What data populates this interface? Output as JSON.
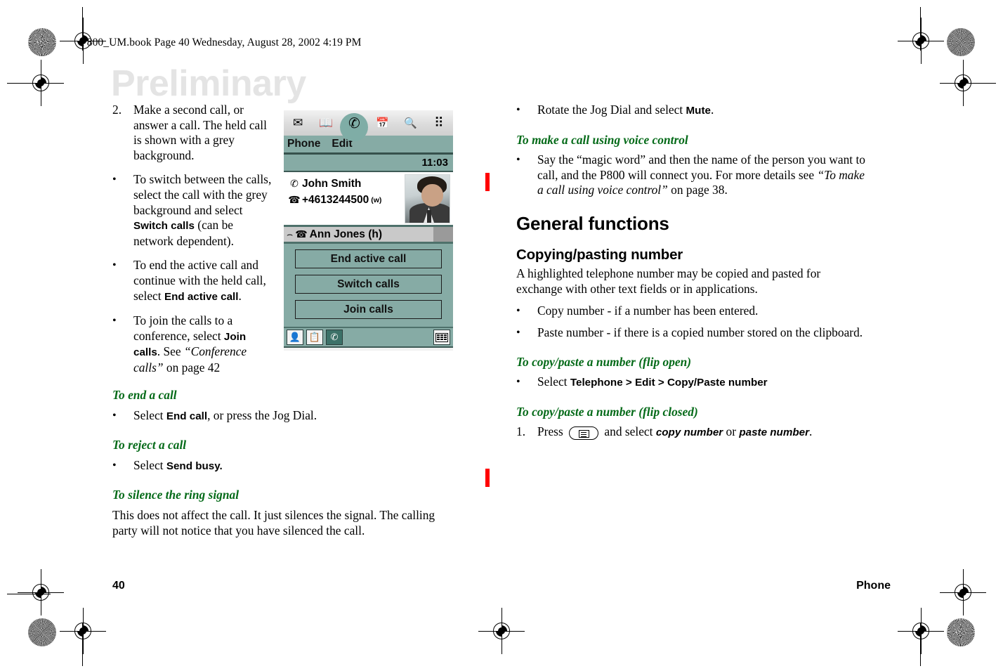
{
  "header": {
    "book_line": "P800_UM.book  Page 40  Wednesday, August 28, 2002  4:19 PM"
  },
  "watermark": {
    "text": "Preliminary"
  },
  "footer": {
    "page_number": "40",
    "chapter": "Phone"
  },
  "left_column": {
    "step2": {
      "marker": "2.",
      "text": "Make a second call, or answer a call. The held call is shown with a grey background."
    },
    "bullets": [
      {
        "marker": "•",
        "pre": "To switch between the calls, select the call with the grey background and select ",
        "ui": "Switch calls",
        "post": " (can be network dependent)."
      },
      {
        "marker": "•",
        "pre": "To end the active call and continue with the held call, select ",
        "ui": "End active call",
        "post": "."
      },
      {
        "marker": "•",
        "pre": "To join the calls to a conference, select ",
        "ui": "Join calls",
        "post": ". See ",
        "italic": "“Conference calls”",
        "tail": " on page 42"
      }
    ],
    "section_end_call": {
      "heading": "To end a call",
      "bullet_marker": "•",
      "pre": "Select ",
      "ui": "End call",
      "post": ", or press the Jog Dial."
    },
    "section_reject_call": {
      "heading": "To reject a call",
      "bullet_marker": "•",
      "pre": "Select ",
      "ui": "Send busy."
    },
    "section_silence": {
      "heading": "To silence the ring signal",
      "body": "This does not affect the call. It just silences the signal. The calling party will not notice that you have silenced the call."
    }
  },
  "right_column": {
    "mute_bullet": {
      "marker": "•",
      "pre": "Rotate the Jog Dial and select ",
      "ui": "Mute",
      "post": "."
    },
    "voice_control": {
      "heading": "To make a call using voice control",
      "bullet_marker": "•",
      "pre": "Say the “magic word” and then the name of the person you want to call, and the P800 will connect you. For more details see ",
      "italic": "“To make a call using voice control”",
      "post": " on page 38."
    },
    "general_functions": {
      "heading": "General functions"
    },
    "copy_paste": {
      "heading": "Copying/pasting number",
      "body": "A highlighted telephone number may be copied and pasted for exchange with other text fields or in applications.",
      "bullets": [
        {
          "marker": "•",
          "text": "Copy number - if a number has been entered."
        },
        {
          "marker": "•",
          "text": "Paste number - if there is a copied number stored on the clipboard."
        }
      ]
    },
    "flip_open": {
      "heading": "To copy/paste a number (flip open)",
      "bullet_marker": "•",
      "pre": "Select ",
      "ui": "Telephone > Edit > Copy/Paste number"
    },
    "flip_closed": {
      "heading": "To copy/paste a number (flip closed)",
      "marker": "1.",
      "pre": "Press ",
      "mid": " and select ",
      "ui1": "copy number",
      "or": " or ",
      "ui2": "paste number",
      "post": "."
    }
  },
  "phone_screenshot": {
    "tabs": [
      {
        "name": "messaging",
        "glyph": "✉",
        "active": false
      },
      {
        "name": "contacts",
        "glyph": "📖",
        "active": false
      },
      {
        "name": "phone",
        "glyph": "✆",
        "active": true
      },
      {
        "name": "calendar",
        "glyph": "📅",
        "active": false
      },
      {
        "name": "search",
        "glyph": "🔍",
        "active": false
      },
      {
        "name": "apps",
        "glyph": "⠿",
        "active": false
      }
    ],
    "menubar": {
      "items": [
        "Phone",
        "Edit"
      ]
    },
    "time": "11:03",
    "active_call": {
      "name": "John Smith",
      "number": "+4613244500",
      "number_type": "(w)",
      "name_icon": "✆",
      "number_icon": "☎"
    },
    "held_call": {
      "label": "Ann Jones (h)",
      "hold_icon": "⌢",
      "phone_icon": "☎"
    },
    "buttons": [
      "End active call",
      "Switch calls",
      "Join calls"
    ],
    "app_buttons": [
      {
        "name": "add-contact",
        "glyph": "👤",
        "selected": false
      },
      {
        "name": "call-list",
        "glyph": "📋",
        "selected": false
      },
      {
        "name": "handset",
        "glyph": "✆",
        "selected": true
      }
    ],
    "app_bar_right": {
      "name": "keypad",
      "glyph": "⌸"
    },
    "status_bar": {
      "signal": "signal-bars-icon",
      "keyboard": "keyboard-icon",
      "handset": "✆",
      "speaker": "speaker-icon",
      "clock": "clock-icon",
      "battery": "battery-icon"
    }
  },
  "colors": {
    "green_heading": "#046a18",
    "change_bar_red": "#ff0000",
    "watermark_gray": "#e4e4e4",
    "phone_teal": "#86aba5",
    "phone_teal_dark": "#3c7168",
    "phone_held_gray": "#c9c9c9"
  }
}
